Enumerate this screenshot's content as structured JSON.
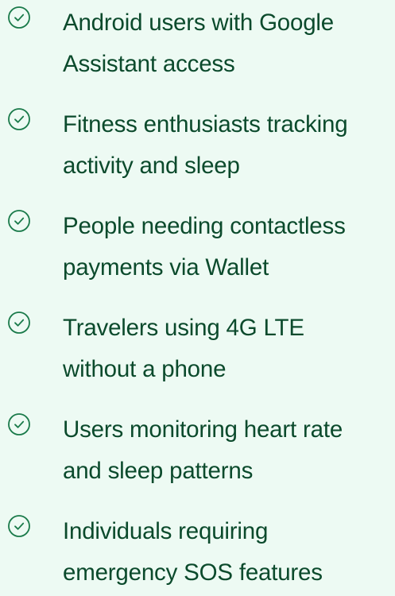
{
  "benefits": {
    "items": [
      {
        "line1": "Android users with Google",
        "line2": "Assistant access"
      },
      {
        "line1": "Fitness enthusiasts tracking",
        "line2": "activity and sleep"
      },
      {
        "line1": "People needing contactless",
        "line2": "payments via Wallet"
      },
      {
        "line1": "Travelers using 4G LTE",
        "line2": "without a phone"
      },
      {
        "line1": "Users monitoring heart rate",
        "line2": "and sleep patterns"
      },
      {
        "line1": "Individuals requiring",
        "line2": "emergency SOS features"
      }
    ]
  },
  "colors": {
    "background": "#edfaf3",
    "text": "#0b4a2c",
    "icon": "#1a7a4a"
  },
  "icons": {
    "bullet": "check-circle-icon"
  }
}
